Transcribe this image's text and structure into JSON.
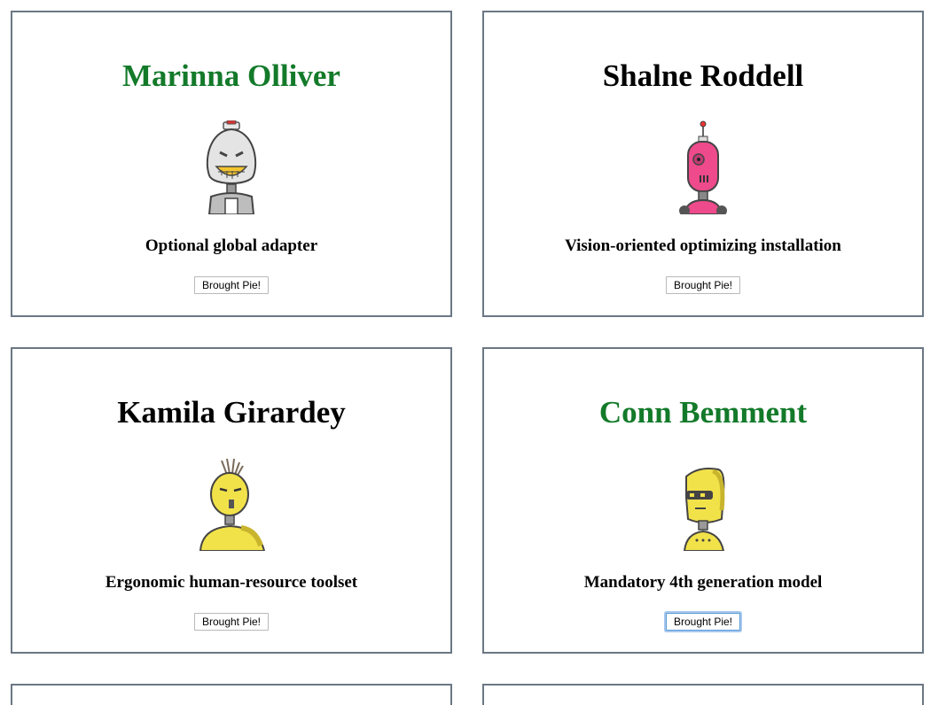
{
  "cards": [
    {
      "name": "Marinna Olliver",
      "name_color": "#137a2a",
      "robot": "white-robot-icon",
      "tagline": "Optional global adapter",
      "button_label": "Brought Pie!"
    },
    {
      "name": "Shalne Roddell",
      "name_color": "#000000",
      "robot": "pink-robot-icon",
      "tagline": "Vision-oriented optimizing installation",
      "button_label": "Brought Pie!"
    },
    {
      "name": "Kamila Girardey",
      "name_color": "#000000",
      "robot": "yellow-robot-icon",
      "tagline": "Ergonomic human-resource toolset",
      "button_label": "Brought Pie!"
    },
    {
      "name": "Conn Bemment",
      "name_color": "#137a2a",
      "robot": "yellow-visor-robot-icon",
      "tagline": "Mandatory 4th generation model",
      "button_label": "Brought Pie!",
      "button_focused": true
    }
  ]
}
